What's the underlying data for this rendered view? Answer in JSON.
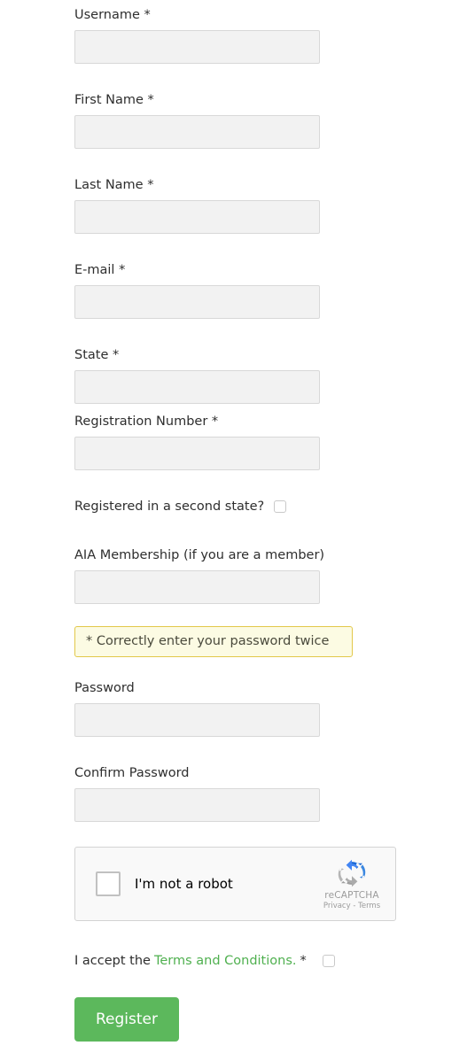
{
  "form": {
    "fields": [
      {
        "label": "Username *",
        "value": "",
        "placeholder": ""
      },
      {
        "label": "First Name *",
        "value": "",
        "placeholder": ""
      },
      {
        "label": "Last Name *",
        "value": "",
        "placeholder": ""
      },
      {
        "label": "E-mail *",
        "value": "",
        "placeholder": ""
      },
      {
        "label": "State *",
        "value": "",
        "placeholder": ""
      },
      {
        "label": "Registration Number *",
        "value": "",
        "placeholder": ""
      },
      {
        "label": "AIA Membership (if you are a member)",
        "value": "",
        "placeholder": ""
      },
      {
        "label": "Password",
        "value": "",
        "placeholder": ""
      },
      {
        "label": "Confirm Password",
        "value": "",
        "placeholder": ""
      }
    ],
    "second_state": {
      "label": "Registered in a second state?",
      "checked": false
    },
    "password_notice": "* Correctly enter your password twice",
    "recaptcha": {
      "checkbox_label": "I'm not a robot",
      "brand": "reCAPTCHA",
      "legal": "Privacy - Terms",
      "checked": false
    },
    "terms": {
      "prefix": "I accept the",
      "link_text": "Terms and Conditions.",
      "required_mark": "*",
      "checked": false
    },
    "submit_label": "Register"
  },
  "colors": {
    "button_green": "#5cb85c",
    "link_green": "#4fb04f",
    "notice_bg": "#fcfbe3",
    "notice_border": "#e2c84a",
    "input_bg": "#f2f2f2",
    "input_border": "#d8d8d8"
  }
}
